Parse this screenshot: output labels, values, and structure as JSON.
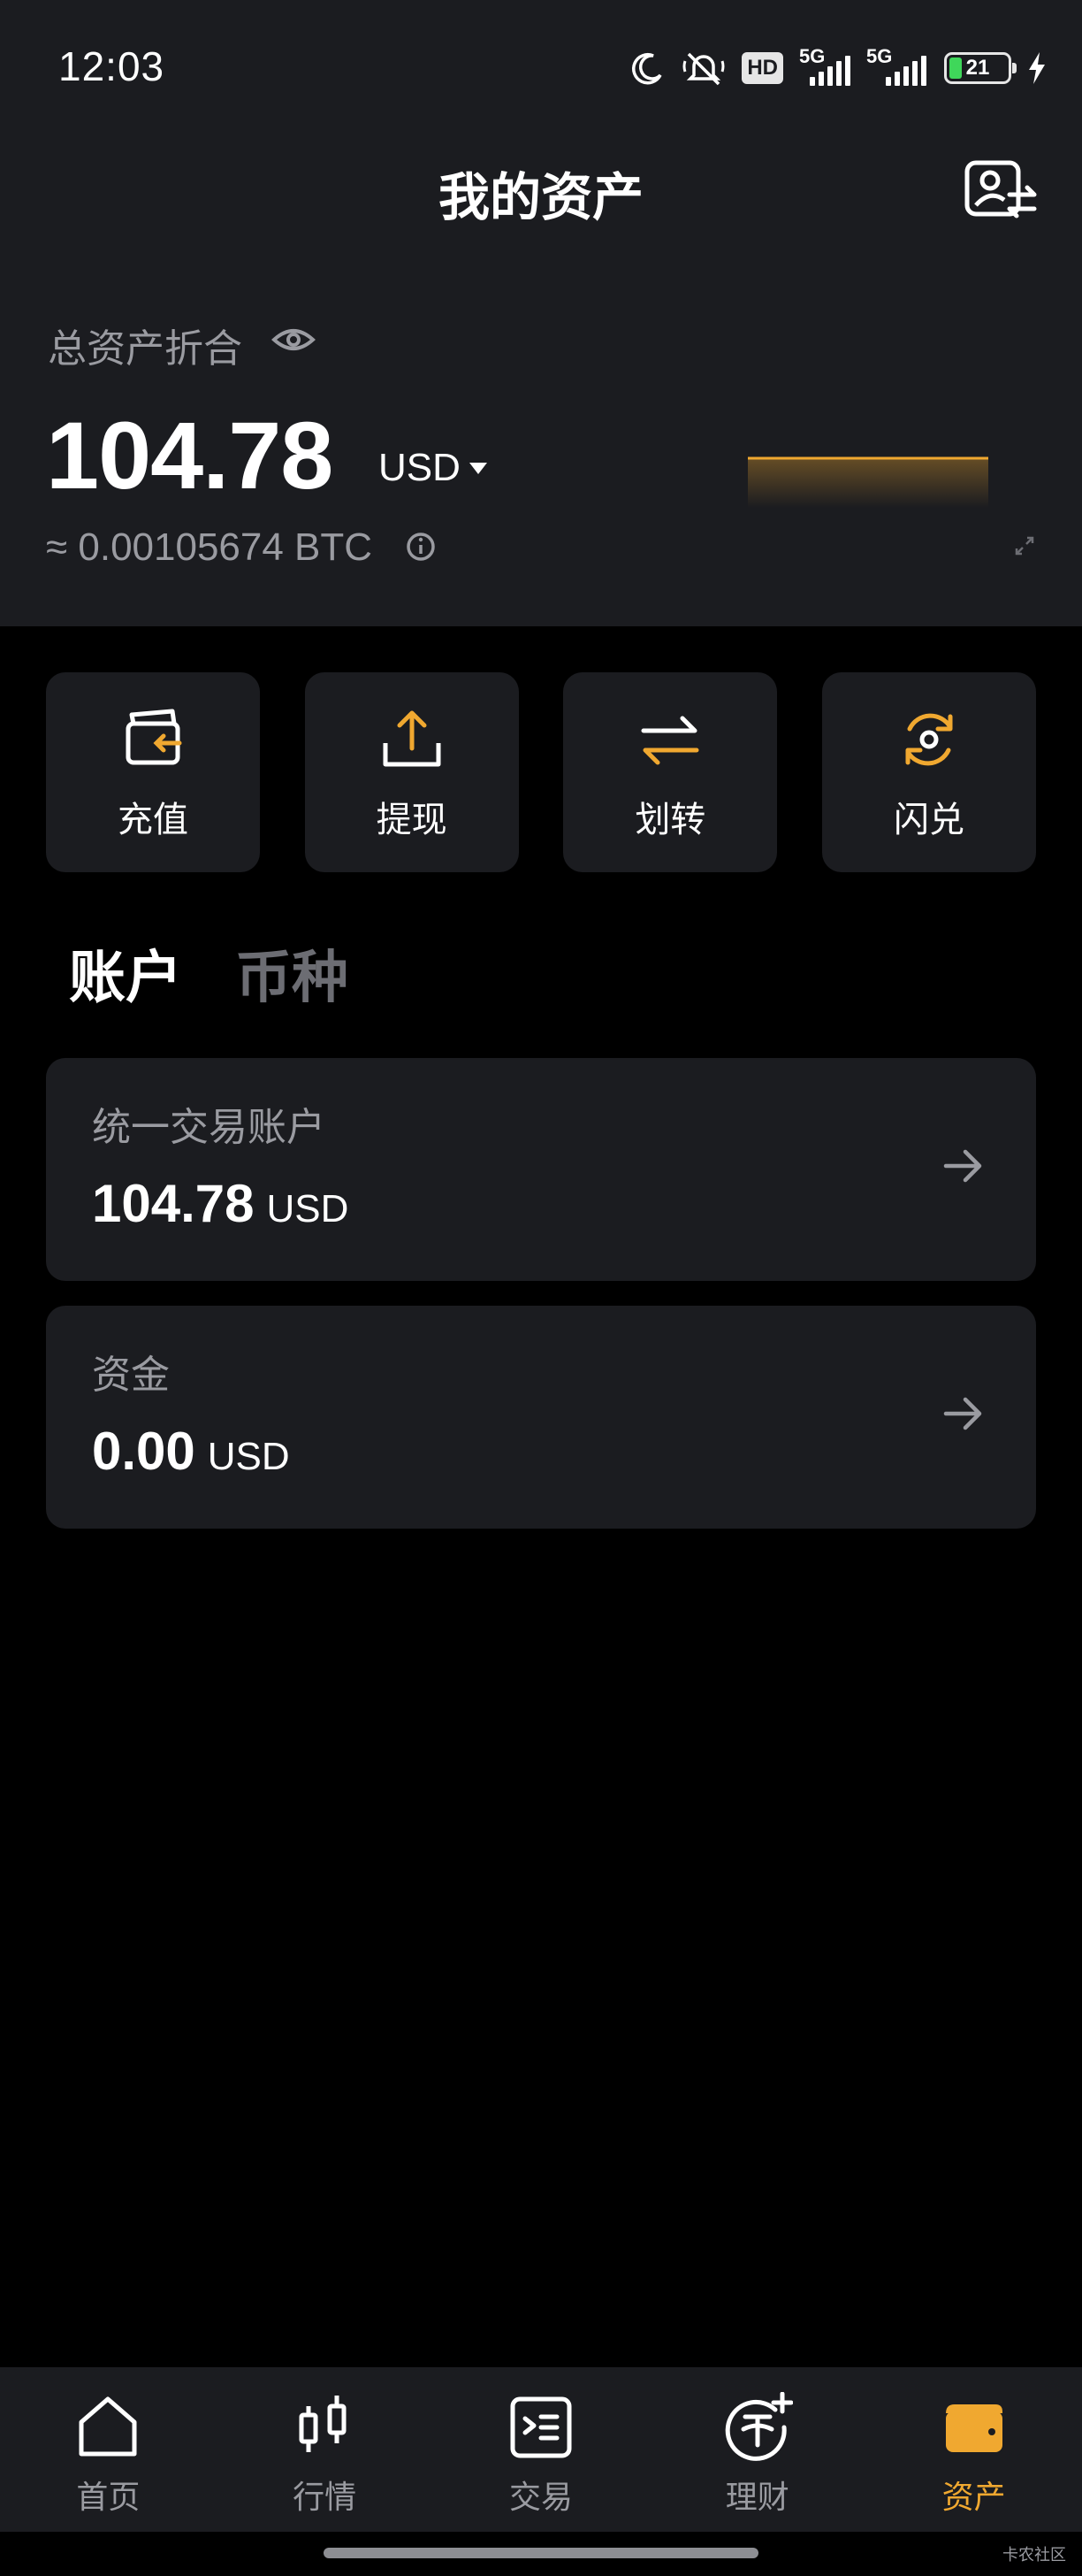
{
  "status_bar": {
    "time": "12:03",
    "hd_badge": "HD",
    "network_1": "5G",
    "network_2": "5G",
    "battery_level": "21",
    "icons": [
      "moon-icon",
      "mute-bell-icon",
      "hd-icon",
      "signal-icon",
      "signal-icon",
      "battery-icon",
      "charging-bolt-icon"
    ]
  },
  "header": {
    "title": "我的资产",
    "action_icon": "profile-switch-icon"
  },
  "summary": {
    "label": "总资产折合",
    "total": "104.78",
    "currency": "USD",
    "btc_equivalent": "≈ 0.00105674 BTC",
    "sparkline_color": "#f0a830"
  },
  "actions": [
    {
      "label": "充值",
      "icon": "deposit-icon"
    },
    {
      "label": "提现",
      "icon": "withdraw-icon"
    },
    {
      "label": "划转",
      "icon": "transfer-icon"
    },
    {
      "label": "闪兑",
      "icon": "flash-exchange-icon"
    }
  ],
  "tabs": [
    {
      "label": "账户",
      "active": true
    },
    {
      "label": "币种",
      "active": false
    }
  ],
  "accounts": [
    {
      "name": "统一交易账户",
      "value": "104.78",
      "unit": "USD"
    },
    {
      "name": "资金",
      "value": "0.00",
      "unit": "USD"
    }
  ],
  "bottom_nav": [
    {
      "label": "首页",
      "icon": "home-icon",
      "active": false
    },
    {
      "label": "行情",
      "icon": "candlestick-icon",
      "active": false
    },
    {
      "label": "交易",
      "icon": "trade-icon",
      "active": false
    },
    {
      "label": "理财",
      "icon": "earn-icon",
      "active": false
    },
    {
      "label": "资产",
      "icon": "wallet-icon",
      "active": true
    }
  ],
  "watermark": "卡农社区",
  "colors": {
    "accent": "#f0a830",
    "surface": "#1b1c20",
    "background": "#000000",
    "muted_text": "#9a9ba1"
  }
}
